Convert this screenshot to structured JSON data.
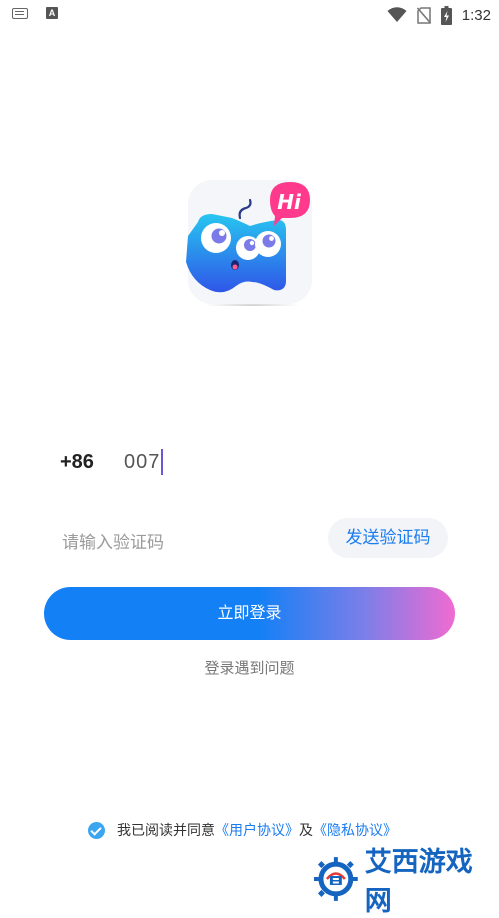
{
  "status_bar": {
    "time": "1:32",
    "icons": [
      "keyboard-icon",
      "a-icon",
      "wifi-icon",
      "no-sim-icon",
      "battery-charging-icon"
    ],
    "a_label": "A"
  },
  "logo": {
    "bubble_text": "Hi",
    "colors": {
      "bubble": "#ff3a8c",
      "body_top": "#27c6f0",
      "body_bottom": "#2f56e8"
    }
  },
  "login": {
    "country_code": "+86",
    "phone_value": "007",
    "code_placeholder": "请输入验证码",
    "send_code_label": "发送验证码",
    "submit_label": "立即登录",
    "trouble_label": "登录遇到问题"
  },
  "agreement": {
    "checked": true,
    "prefix": "我已阅读并同意",
    "user_agreement": "《用户协议》",
    "connector": "及",
    "privacy_policy": "《隐私协议》"
  },
  "watermark": {
    "text": "艾西游戏网"
  },
  "colors": {
    "accent_blue": "#1380f6",
    "accent_pink": "#f06bd2",
    "link_blue": "#1a7cf0"
  }
}
